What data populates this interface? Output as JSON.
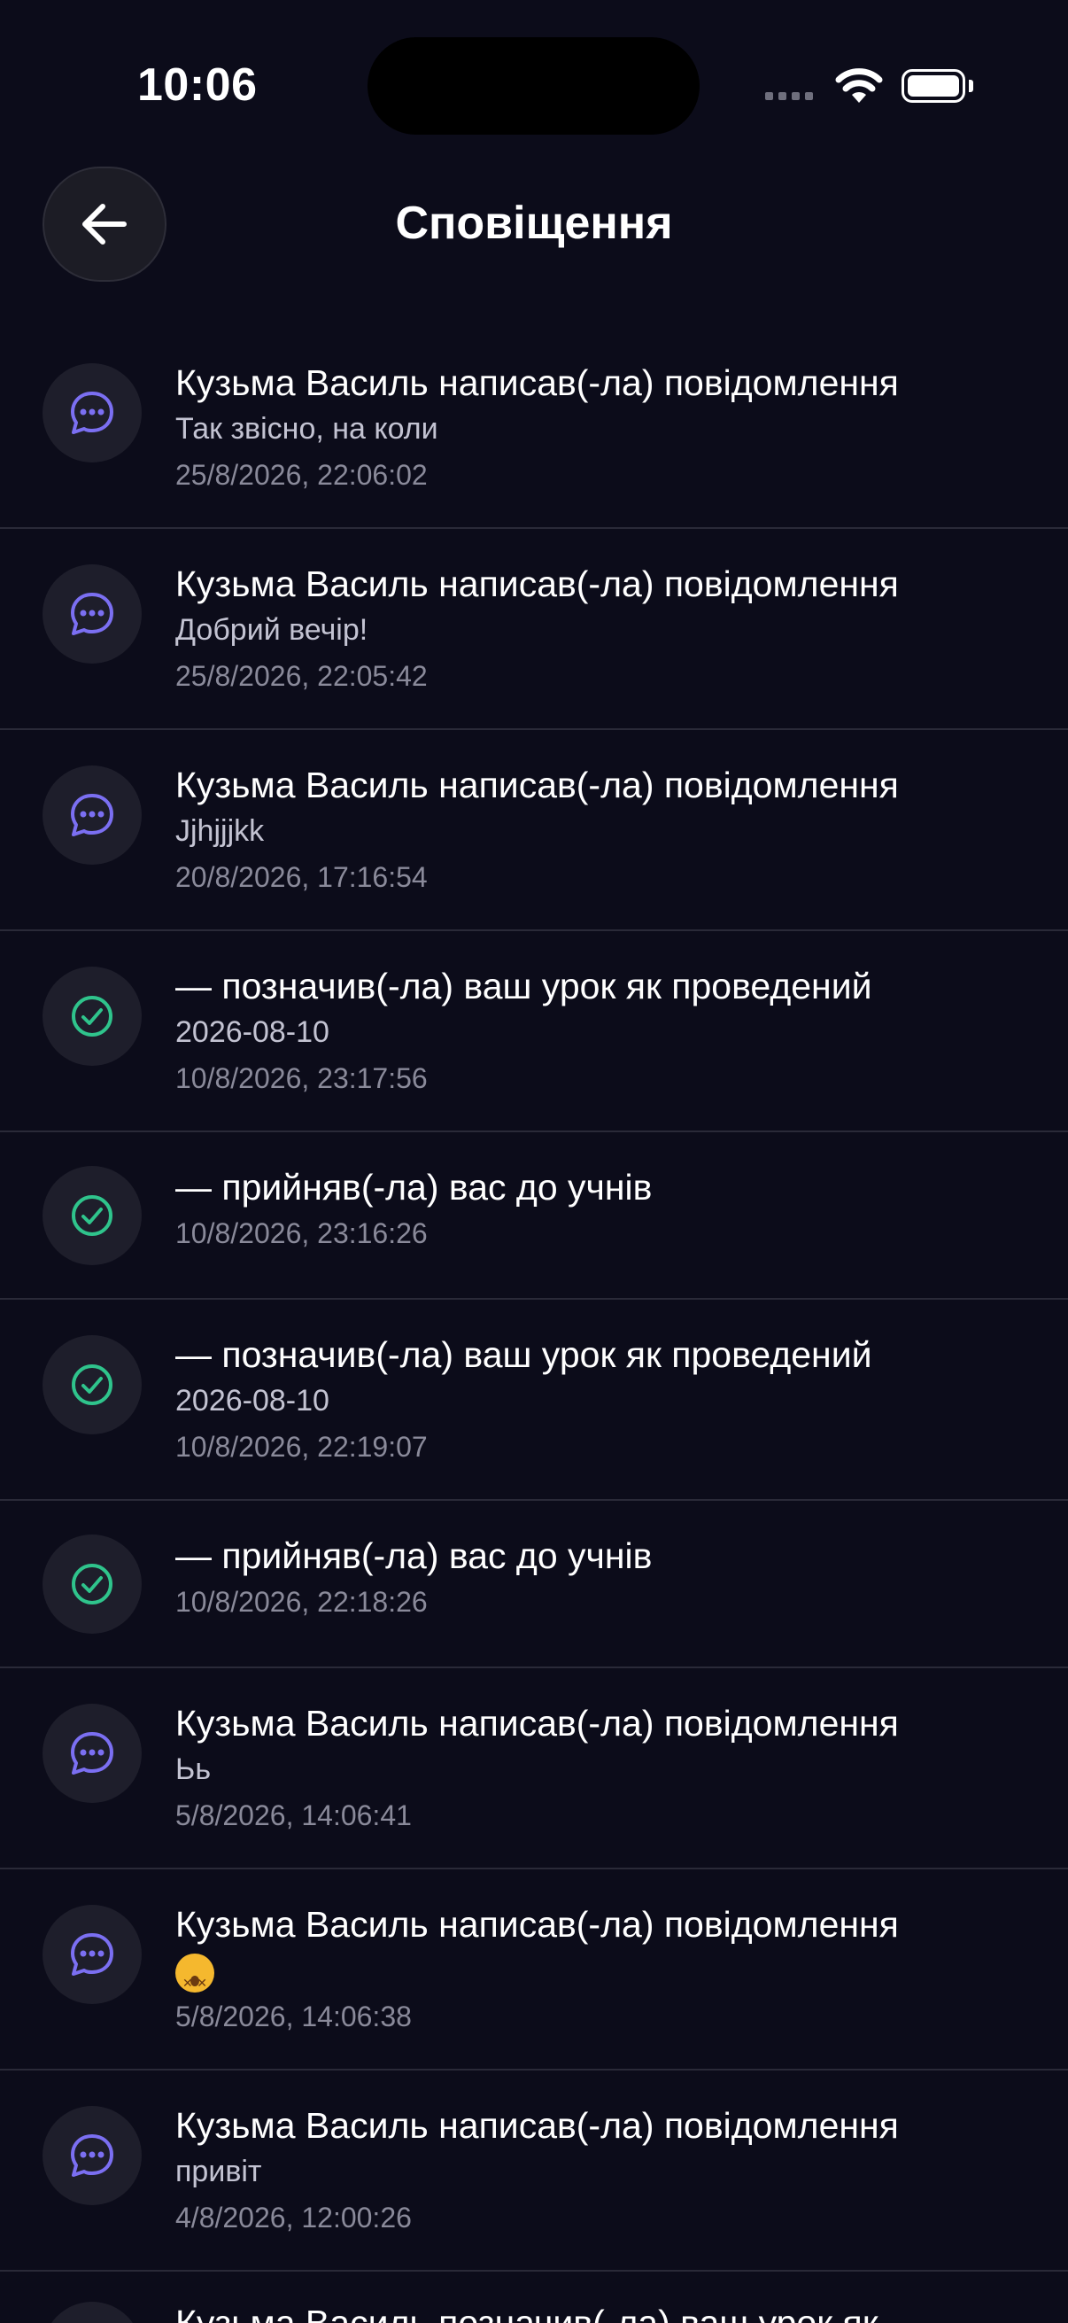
{
  "status_bar": {
    "time": "10:06"
  },
  "header": {
    "title": "Сповіщення",
    "back_icon": "arrow-left-icon"
  },
  "colors": {
    "background": "#0c0c1a",
    "message_icon": "#7b6ff2",
    "check_icon": "#2fc48c",
    "divider": "#2a2a38"
  },
  "notifications": [
    {
      "type": "message",
      "icon": "chat-bubble-icon",
      "title": "Кузьма Василь написав(-ла) повідомлення",
      "subtitle": "Так звісно, на коли",
      "date": "25/8/2026, 22:06:02"
    },
    {
      "type": "message",
      "icon": "chat-bubble-icon",
      "title": "Кузьма Василь написав(-ла) повідомлення",
      "subtitle": "Добрий вечір!",
      "date": "25/8/2026, 22:05:42"
    },
    {
      "type": "message",
      "icon": "chat-bubble-icon",
      "title": "Кузьма Василь написав(-ла) повідомлення",
      "subtitle": "Jjhjjjkk",
      "date": "20/8/2026, 17:16:54"
    },
    {
      "type": "check",
      "icon": "check-circle-icon",
      "title": "— позначив(-ла) ваш урок як проведений",
      "subtitle": "2026-08-10",
      "date": "10/8/2026, 23:17:56"
    },
    {
      "type": "check",
      "icon": "check-circle-icon",
      "title": "— прийняв(-ла) вас до учнів",
      "subtitle": "",
      "date": "10/8/2026, 23:16:26"
    },
    {
      "type": "check",
      "icon": "check-circle-icon",
      "title": "— позначив(-ла) ваш урок як проведений",
      "subtitle": "2026-08-10",
      "date": "10/8/2026, 22:19:07"
    },
    {
      "type": "check",
      "icon": "check-circle-icon",
      "title": "— прийняв(-ла) вас до учнів",
      "subtitle": "",
      "date": "10/8/2026, 22:18:26"
    },
    {
      "type": "message",
      "icon": "chat-bubble-icon",
      "title": "Кузьма Василь написав(-ла) повідомлення",
      "subtitle": "Ьь",
      "date": "5/8/2026, 14:06:41"
    },
    {
      "type": "message",
      "icon": "chat-bubble-icon",
      "title": "Кузьма Василь написав(-ла) повідомлення",
      "subtitle": "",
      "emoji": "dizzy-face-emoji",
      "date": "5/8/2026, 14:06:38"
    },
    {
      "type": "message",
      "icon": "chat-bubble-icon",
      "title": "Кузьма Василь написав(-ла) повідомлення",
      "subtitle": "привіт",
      "date": "4/8/2026, 12:00:26"
    }
  ],
  "partial_item": {
    "icon": "chat-bubble-icon",
    "title": "Кузьма Василь позначив(-ла) ваш урок як"
  }
}
